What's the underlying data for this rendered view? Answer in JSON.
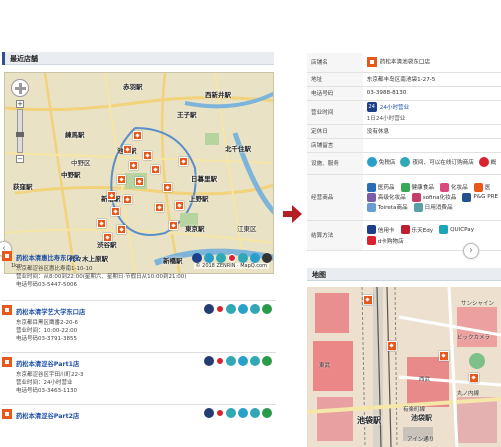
{
  "left": {
    "section_title": "最近店舗",
    "map": {
      "stations": [
        {
          "name": "赤羽駅"
        },
        {
          "name": "西新井駅"
        },
        {
          "name": "王子駅"
        },
        {
          "name": "練馬駅"
        },
        {
          "name": "池袋駅"
        },
        {
          "name": "北千住駅"
        },
        {
          "name": "新宿駅"
        },
        {
          "name": "日暮里駅"
        },
        {
          "name": "荻窪駅"
        },
        {
          "name": "中野駅"
        },
        {
          "name": "上野駅"
        },
        {
          "name": "東京駅"
        },
        {
          "name": "渋谷駅"
        },
        {
          "name": "代々木上原駅"
        },
        {
          "name": "新橋駅"
        },
        {
          "name": "江東区"
        },
        {
          "name": "中野区"
        }
      ],
      "copyright": "© 2018 ZENRIN · MapQ.com",
      "scale_label": "1km"
    },
    "stores": [
      {
        "name": "药松本清惠比寿东口店",
        "lines": [
          "东京都涩谷区惠比寿南1-10-10",
          "营业时间：从8:00到22:00(星期六、星期日·节假日从10:00到21:00)",
          "电话号码03-5447-5006"
        ]
      },
      {
        "name": "药松本清学艺大学东口店",
        "lines": [
          "东京都目黑区鹰番2-20-6",
          "营业时间：10:00-22:00",
          "电话号码03-3791-3855"
        ]
      },
      {
        "name": "药松本清涩谷Part1店",
        "lines": [
          "东京都涩谷区宇田川町22-3",
          "营业时间：24小时营业",
          "电话号码03-3463-1130"
        ]
      },
      {
        "name": "药松本清涩谷Part2店",
        "lines": []
      }
    ]
  },
  "right": {
    "info_rows": [
      {
        "key": "店铺名",
        "value": "药松本清池袋东口店"
      },
      {
        "key": "地址",
        "value": "东京都丰岛区南池袋1-27-5"
      },
      {
        "key": "电话号码",
        "value": "03-3988-8130"
      },
      {
        "key": "营业时间",
        "badge": "24",
        "value": "24小时营业",
        "sub": "1日24小时营业"
      },
      {
        "key": "定休日",
        "value": "没有休息"
      },
      {
        "key": "店铺留言",
        "value": ""
      },
      {
        "key": "设施、服务",
        "tags": [
          "免税店",
          "夜间、可以在线订购商店",
          "概"
        ]
      },
      {
        "key": "经营商品",
        "products": [
          [
            "医药品",
            "健康食品",
            "化妆品",
            "医"
          ],
          [
            "高级化妆品",
            "sofina化妆品",
            "P&G PRE"
          ],
          [
            "Toireta商品",
            "日用消费品",
            ""
          ]
        ]
      },
      {
        "key": "结算方法",
        "payments": [
          "信用卡",
          "乐天Edy",
          "QUICPay"
        ],
        "payment_extra": "d卡购物店"
      }
    ],
    "map_title": "地图",
    "map": {
      "labels": [
        "池袋駅",
        "有楽町線",
        "池袋駅",
        "東武",
        "西武",
        "ビックカメラ",
        "丸ノ内線",
        "サンシャイン",
        "アイン通り"
      ]
    }
  },
  "colors": {
    "accent_orange": "#e8581a",
    "link_blue": "#1e4fa8",
    "arrow_red": "#b31f24"
  }
}
